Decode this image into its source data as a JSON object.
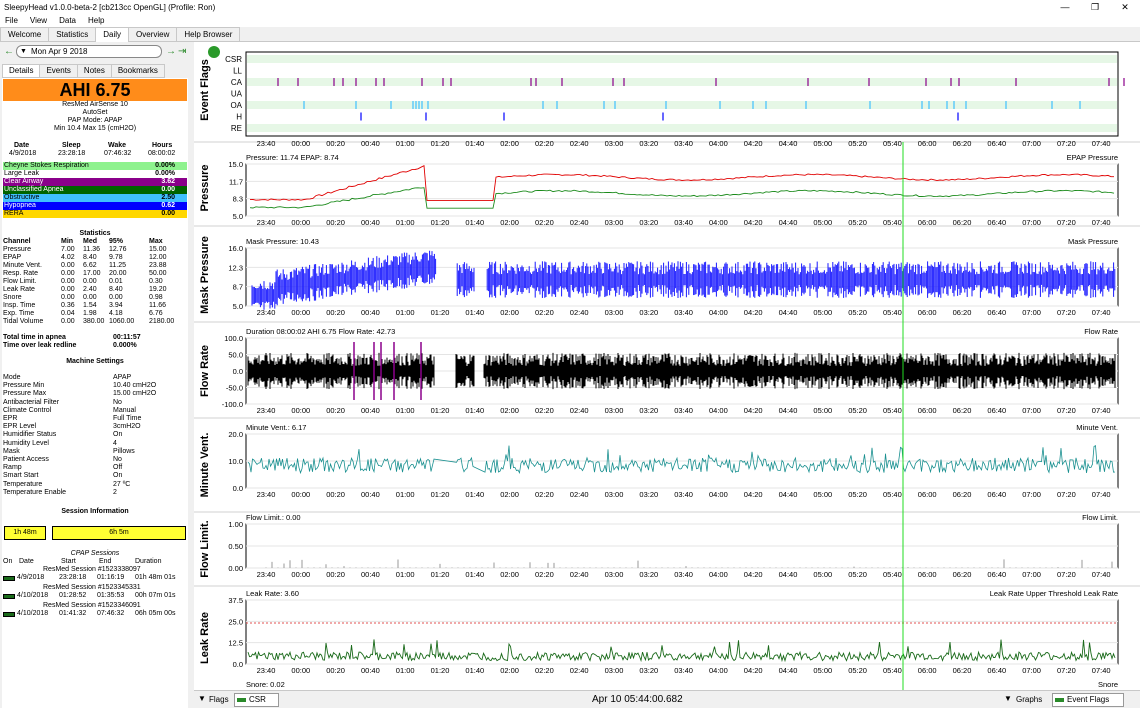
{
  "window": {
    "title": "SleepyHead v1.0.0-beta-2 [cb213cc OpenGL] (Profile: Ron)",
    "minimize": "—",
    "maximize": "❐",
    "close": "✕"
  },
  "menu": [
    "File",
    "View",
    "Data",
    "Help"
  ],
  "tabs": [
    "Welcome",
    "Statistics",
    "Daily",
    "Overview",
    "Help Browser"
  ],
  "date_nav": {
    "date": "Mon Apr 9 2018",
    "prev": "←",
    "next": "→",
    "last": "⇥"
  },
  "subtabs": [
    "Details",
    "Events",
    "Notes",
    "Bookmarks"
  ],
  "ahi_label": "AHI 6.75",
  "machine": {
    "model": "ResMed AirSense 10",
    "mode": "AutoSet",
    "pap_mode": "PAP Mode: APAP",
    "pressure": "Min 10.4 Max 15 (cmH2O)"
  },
  "summary": {
    "headers": [
      "Date",
      "Sleep",
      "Wake",
      "Hours"
    ],
    "values": [
      "4/9/2018",
      "23:28:18",
      "07:46:32",
      "08:00:02"
    ]
  },
  "events": [
    {
      "label": "Cheyne Stokes Respiration",
      "value": "0.00%",
      "color": "#8ef28e",
      "text": "#000"
    },
    {
      "label": "Large Leak",
      "value": "0.00%",
      "color": "#ffffff",
      "text": "#000"
    },
    {
      "label": "Clear Airway",
      "value": "3.62",
      "color": "#8a008a",
      "text": "#fff"
    },
    {
      "label": "Unclassified Apnea",
      "value": "0.00",
      "color": "#006400",
      "text": "#fff"
    },
    {
      "label": "Obstructive",
      "value": "2.50",
      "color": "#40c0ff",
      "text": "#000"
    },
    {
      "label": "Hypopnea",
      "value": "0.62",
      "color": "#0000ff",
      "text": "#fff"
    },
    {
      "label": "RERA",
      "value": "0.00",
      "color": "#ffd700",
      "text": "#000"
    }
  ],
  "statistics": {
    "title": "Statistics",
    "headers": [
      "Channel",
      "Min",
      "Med",
      "95%",
      "Max"
    ],
    "rows": [
      [
        "Pressure",
        "7.00",
        "11.36",
        "12.76",
        "15.00"
      ],
      [
        "EPAP",
        "4.02",
        "8.40",
        "9.78",
        "12.00"
      ],
      [
        "Minute Vent.",
        "0.00",
        "6.62",
        "11.25",
        "23.88"
      ],
      [
        "Resp. Rate",
        "0.00",
        "17.00",
        "20.00",
        "50.00"
      ],
      [
        "Flow Limit.",
        "0.00",
        "0.00",
        "0.01",
        "0.30"
      ],
      [
        "Leak Rate",
        "0.00",
        "2.40",
        "8.40",
        "19.20"
      ],
      [
        "Snore",
        "0.00",
        "0.00",
        "0.00",
        "0.98"
      ],
      [
        "Insp. Time",
        "0.36",
        "1.54",
        "3.94",
        "11.66"
      ],
      [
        "Exp. Time",
        "0.04",
        "1.98",
        "4.18",
        "6.76"
      ],
      [
        "Tidal Volume",
        "0.00",
        "380.00",
        "1060.00",
        "2180.00"
      ]
    ]
  },
  "apnea_time": [
    {
      "label": "Total time in apnea",
      "value": "00:11:57"
    },
    {
      "label": "Time over leak redline",
      "value": "0.000%"
    }
  ],
  "machine_settings": {
    "title": "Machine Settings",
    "rows": [
      [
        "Mode",
        "APAP"
      ],
      [
        "Pressure Min",
        "10.40 cmH2O"
      ],
      [
        "Pressure Max",
        "15.00 cmH2O"
      ],
      [
        "Antibacterial Filter",
        "No"
      ],
      [
        "Climate Control",
        "Manual"
      ],
      [
        "EPR",
        "Full Time"
      ],
      [
        "EPR Level",
        "3cmH2O"
      ],
      [
        "Humidifier Status",
        "On"
      ],
      [
        "Humidity Level",
        "4"
      ],
      [
        "Mask",
        "Pillows"
      ],
      [
        "Patient Access",
        "No"
      ],
      [
        "Ramp",
        "Off"
      ],
      [
        "Smart Start",
        "On"
      ],
      [
        "Temperature",
        "27 ºC"
      ],
      [
        "Temperature Enable",
        "2"
      ]
    ]
  },
  "session_info": {
    "title": "Session Information",
    "bar1": "1h 48m",
    "bar2": "6h 5m",
    "cpap_title": "CPAP Sessions",
    "headers": [
      "On",
      "Date",
      "Start",
      "End",
      "Duration"
    ],
    "sessions": [
      {
        "name": "ResMed Session #1523338097",
        "date": "4/9/2018",
        "start": "23:28:18",
        "end": "01:16:19",
        "dur": "01h 48m 01s"
      },
      {
        "name": "ResMed Session #1523345331",
        "date": "4/10/2018",
        "start": "01:28:52",
        "end": "01:35:53",
        "dur": "00h 07m 01s"
      },
      {
        "name": "ResMed Session #1523346091",
        "date": "4/10/2018",
        "start": "01:41:32",
        "end": "07:46:32",
        "dur": "06h 05m 00s"
      }
    ]
  },
  "time_ticks": [
    "23:40",
    "00:00",
    "00:20",
    "00:40",
    "01:00",
    "01:20",
    "01:40",
    "02:00",
    "02:20",
    "02:40",
    "03:00",
    "03:20",
    "03:40",
    "04:00",
    "04:20",
    "04:40",
    "05:00",
    "05:20",
    "05:40",
    "06:00",
    "06:20",
    "06:40",
    "07:00",
    "07:20",
    "07:40"
  ],
  "charts": {
    "flags": {
      "label": "Event Flags",
      "rows": [
        "CSR",
        "LL",
        "CA",
        "UA",
        "OA",
        "H",
        "RE"
      ]
    },
    "pressure": {
      "label": "Pressure",
      "caption": "Pressure: 11.74 EPAP: 8.74",
      "legend": "EPAP Pressure",
      "yticks": [
        "15.0",
        "11.7",
        "8.3",
        "5.0"
      ]
    },
    "mask": {
      "label": "Mask Pressure",
      "caption": "Mask Pressure: 10.43",
      "legend": "Mask Pressure",
      "yticks": [
        "16.0",
        "12.3",
        "8.7",
        "5.0"
      ]
    },
    "flow": {
      "label": "Flow Rate",
      "caption": "Duration 08:00:02 AHI 6.75 Flow Rate: 42.73",
      "legend": "Flow Rate",
      "yticks": [
        "100.0",
        "50.0",
        "0.0",
        "-50.0",
        "-100.0"
      ]
    },
    "minvent": {
      "label": "Minute Vent.",
      "caption": "Minute Vent.: 6.17",
      "legend": "Minute Vent.",
      "yticks": [
        "20.0",
        "10.0",
        "0.0"
      ]
    },
    "flowlim": {
      "label": "Flow Limit.",
      "caption": "Flow Limit.: 0.00",
      "legend": "Flow Limit.",
      "yticks": [
        "1.00",
        "0.50",
        "0.00"
      ]
    },
    "leak": {
      "label": "Leak Rate",
      "caption": "Leak Rate: 3.60",
      "legend": "Leak Rate Upper Threshold  Leak Rate",
      "yticks": [
        "37.5",
        "25.0",
        "12.5",
        "0.0"
      ]
    },
    "snore": {
      "caption": "Snore: 0.02",
      "legend": "Snore"
    }
  },
  "bottom": {
    "flags_btn": "Flags",
    "csr": "CSR",
    "timestamp": "Apr 10 05:44:00.682",
    "graphs_btn": "Graphs",
    "event_flags": "Event Flags"
  }
}
